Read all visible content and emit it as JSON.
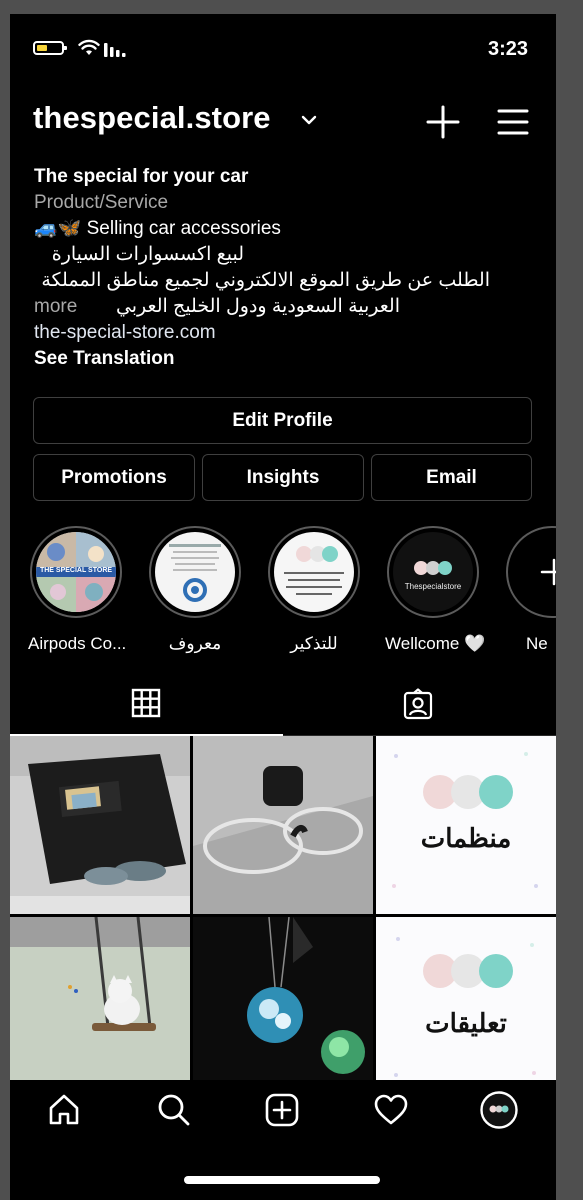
{
  "status": {
    "time": "3:23"
  },
  "header": {
    "username": "thespecial.store"
  },
  "bio": {
    "name": "The special for your car",
    "category": "Product/Service",
    "emoji": "🚙🦋",
    "line1": "Selling car accessories",
    "line2": "لبيع اكسسوارات السيارة",
    "line3": "الطلب عن طريق الموقع الالكتروني لجميع مناطق المملكة",
    "line4": "العربية السعودية ودول الخليج العربي",
    "more": "more",
    "link": "the-special-store.com",
    "see_translation": "See Translation"
  },
  "buttons": {
    "edit_profile": "Edit Profile",
    "promotions": "Promotions",
    "insights": "Insights",
    "email": "Email"
  },
  "highlights": [
    {
      "label": "Airpods Co...",
      "cover_text": "THE SPECIAL STORE"
    },
    {
      "label": "معروف"
    },
    {
      "label": "للتذكير"
    },
    {
      "label": "Wellcome 🤍",
      "cover_text": "Thespecialstore"
    },
    {
      "label": "Ne"
    }
  ],
  "posts": [
    {
      "kind": "visor-organizer"
    },
    {
      "kind": "glasses-clip"
    },
    {
      "kind": "text",
      "text": "منظمات"
    },
    {
      "kind": "swing-cat"
    },
    {
      "kind": "glow-necklace"
    },
    {
      "kind": "text",
      "text": "تعليقات"
    }
  ],
  "icons": {
    "status": [
      "battery-icon",
      "wifi-icon",
      "signal-icon"
    ],
    "header": [
      "chevron-down-icon",
      "plus-icon",
      "menu-icon"
    ],
    "tabs": [
      "grid-icon",
      "tagged-icon"
    ],
    "nav": [
      "home-icon",
      "search-icon",
      "create-icon",
      "heart-icon",
      "profile-avatar-icon"
    ]
  },
  "colors": {
    "background": "#000000",
    "button_border": "#3f3f3f",
    "secondary_text": "#a8a8a8",
    "battery": "#f6d33a",
    "teal_dot": "#7fd3c8",
    "pink_dot": "#f0d8d8"
  }
}
